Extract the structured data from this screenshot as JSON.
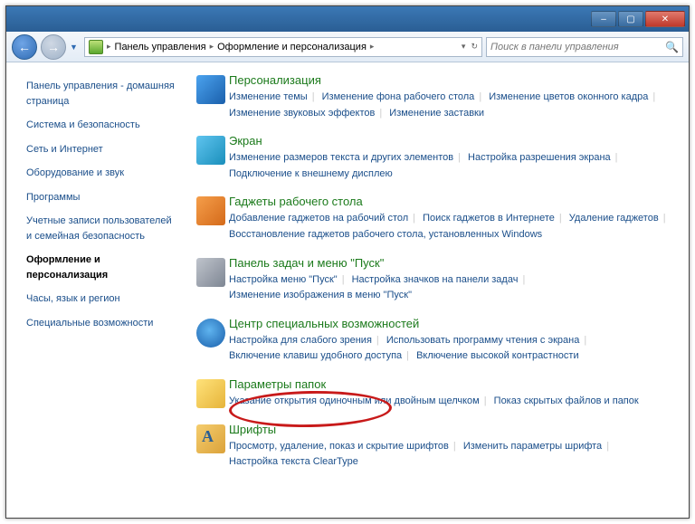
{
  "titlebar": {
    "min": "–",
    "max": "▢",
    "close": "✕"
  },
  "nav": {
    "crumb1": "Панель управления",
    "crumb2": "Оформление и персонализация",
    "search_placeholder": "Поиск в панели управления"
  },
  "sidebar": {
    "home": "Панель управления - домашняя страница",
    "items": [
      "Система и безопасность",
      "Сеть и Интернет",
      "Оборудование и звук",
      "Программы",
      "Учетные записи пользователей и семейная безопасность",
      "Оформление и персонализация",
      "Часы, язык и регион",
      "Специальные возможности"
    ],
    "active_index": 5
  },
  "sections": [
    {
      "title": "Персонализация",
      "icon": "ic1",
      "links": [
        "Изменение темы",
        "Изменение фона рабочего стола",
        "Изменение цветов оконного кадра",
        "Изменение звуковых эффектов",
        "Изменение заставки"
      ]
    },
    {
      "title": "Экран",
      "icon": "ic2",
      "links": [
        "Изменение размеров текста и других элементов",
        "Настройка разрешения экрана",
        "Подключение к внешнему дисплею"
      ]
    },
    {
      "title": "Гаджеты рабочего стола",
      "icon": "ic3",
      "links": [
        "Добавление гаджетов на рабочий стол",
        "Поиск гаджетов в Интернете",
        "Удаление гаджетов",
        "Восстановление гаджетов рабочего стола, установленных Windows"
      ]
    },
    {
      "title": "Панель задач и меню \"Пуск\"",
      "icon": "ic4",
      "links": [
        "Настройка меню \"Пуск\"",
        "Настройка значков на панели задач",
        "Изменение изображения в меню \"Пуск\""
      ]
    },
    {
      "title": "Центр специальных возможностей",
      "icon": "ic5",
      "links": [
        "Настройка для слабого зрения",
        "Использовать программу чтения с экрана",
        "Включение клавиш удобного доступа",
        "Включение высокой контрастности"
      ]
    },
    {
      "title": "Параметры папок",
      "icon": "ic6",
      "links": [
        "Указание открытия одиночным или двойным щелчком",
        "Показ скрытых файлов и папок"
      ]
    },
    {
      "title": "Шрифты",
      "icon": "ic7",
      "links": [
        "Просмотр, удаление, показ и скрытие шрифтов",
        "Изменить параметры шрифта",
        "Настройка текста ClearType"
      ]
    }
  ]
}
